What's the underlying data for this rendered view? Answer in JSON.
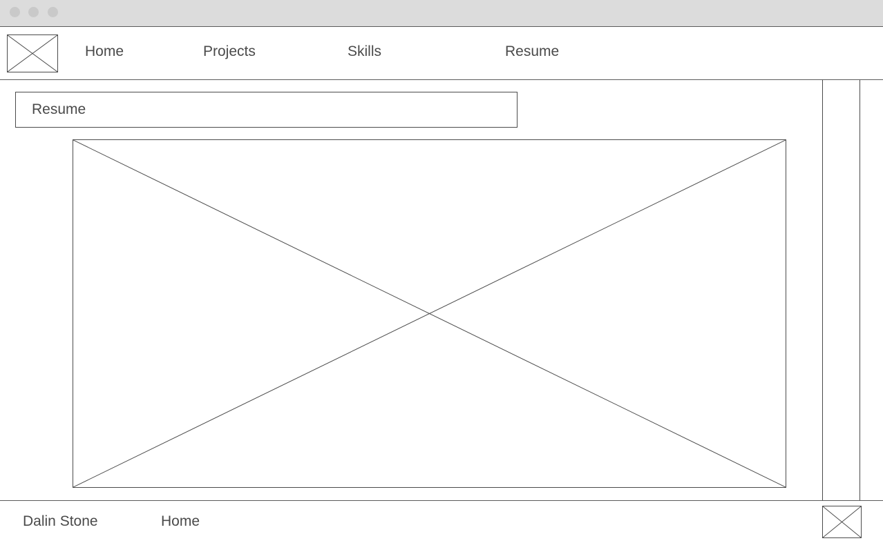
{
  "window": {
    "controls": [
      "window-dot",
      "window-dot",
      "window-dot"
    ]
  },
  "header": {
    "logo_icon": "image-placeholder-icon",
    "nav": {
      "home": "Home",
      "projects": "Projects",
      "skills": "Skills",
      "resume": "Resume"
    }
  },
  "main": {
    "title": "Resume",
    "hero_image_icon": "image-placeholder-icon"
  },
  "footer": {
    "name": "Dalin Stone",
    "home_link": "Home",
    "badge_icon": "image-placeholder-icon"
  },
  "colors": {
    "chrome": "#dcdcdc",
    "line": "#4a4a4a",
    "text": "#4a4a4a",
    "background": "#ffffff"
  }
}
